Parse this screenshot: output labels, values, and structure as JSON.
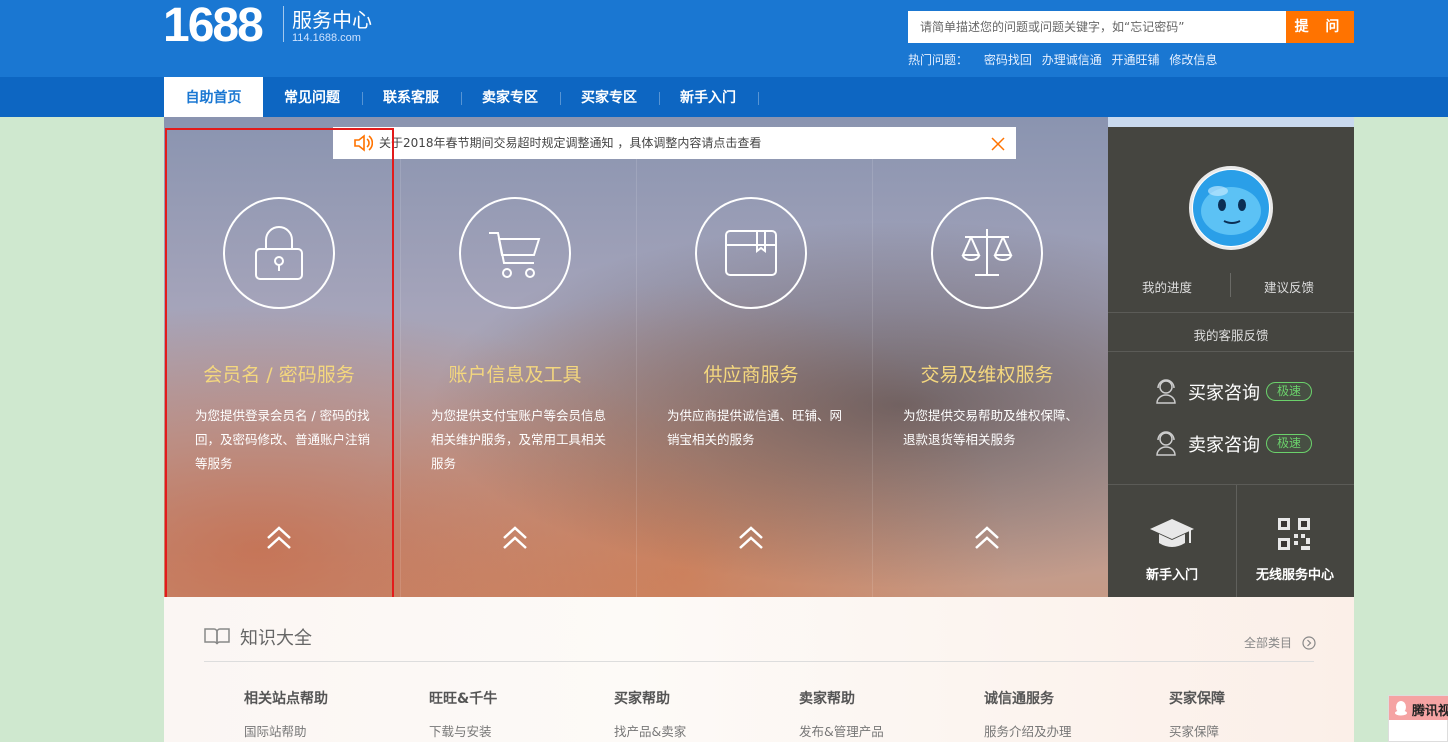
{
  "header": {
    "logo_number": "1688",
    "logo_title": "服务中心",
    "logo_domain": "114.1688.com",
    "search_placeholder": "请简单描述您的问题或问题关键字，如“忘记密码”",
    "search_button": "提 问",
    "hot_label": "热门问题：",
    "hot_links": [
      "密码找回",
      "办理诚信通",
      "开通旺铺",
      "修改信息"
    ]
  },
  "nav": {
    "items": [
      "自助首页",
      "常见问题",
      "联系客服",
      "卖家专区",
      "买家专区",
      "新手入门"
    ],
    "active_index": 0
  },
  "notice": {
    "text": "关于2018年春节期间交易超时规定调整通知 ，具体调整内容请点击查看"
  },
  "services": [
    {
      "title": "会员名 / 密码服务",
      "desc": "为您提供登录会员名 / 密码的找回，及密码修改、普通账户注销等服务",
      "icon": "lock-icon"
    },
    {
      "title": "账户信息及工具",
      "desc": "为您提供支付宝账户等会员信息相关维护服务，及常用工具相关服务",
      "icon": "cart-icon"
    },
    {
      "title": "供应商服务",
      "desc": "为供应商提供诚信通、旺铺、网销宝相关的服务",
      "icon": "box-icon"
    },
    {
      "title": "交易及维权服务",
      "desc": "为您提供交易帮助及维权保障、退款退货等相关服务",
      "icon": "scale-icon"
    }
  ],
  "right_panel": {
    "my_progress": "我的进度",
    "suggestion": "建议反馈",
    "my_feedback": "我的客服反馈",
    "buyer_consult": "买家咨询",
    "seller_consult": "卖家咨询",
    "badge": "极速",
    "newbie": "新手入门",
    "mobile": "无线服务中心"
  },
  "knowledge": {
    "title": "知识大全",
    "all_link": "全部类目",
    "categories": [
      {
        "name": "相关站点帮助",
        "sub": "国际站帮助"
      },
      {
        "name": "旺旺&千牛",
        "sub": "下载与安装"
      },
      {
        "name": "买家帮助",
        "sub": "找产品&卖家"
      },
      {
        "name": "卖家帮助",
        "sub": "发布&管理产品"
      },
      {
        "name": "诚信通服务",
        "sub": "服务介绍及办理"
      },
      {
        "name": "买家保障",
        "sub": "买家保障"
      }
    ]
  },
  "qq_widget": {
    "text": "腾讯视"
  },
  "colors": {
    "brand_blue": "#1a77d2",
    "accent_orange": "#ff7300",
    "title_gold": "#f4d77e",
    "highlight_red": "#e31b1b"
  }
}
